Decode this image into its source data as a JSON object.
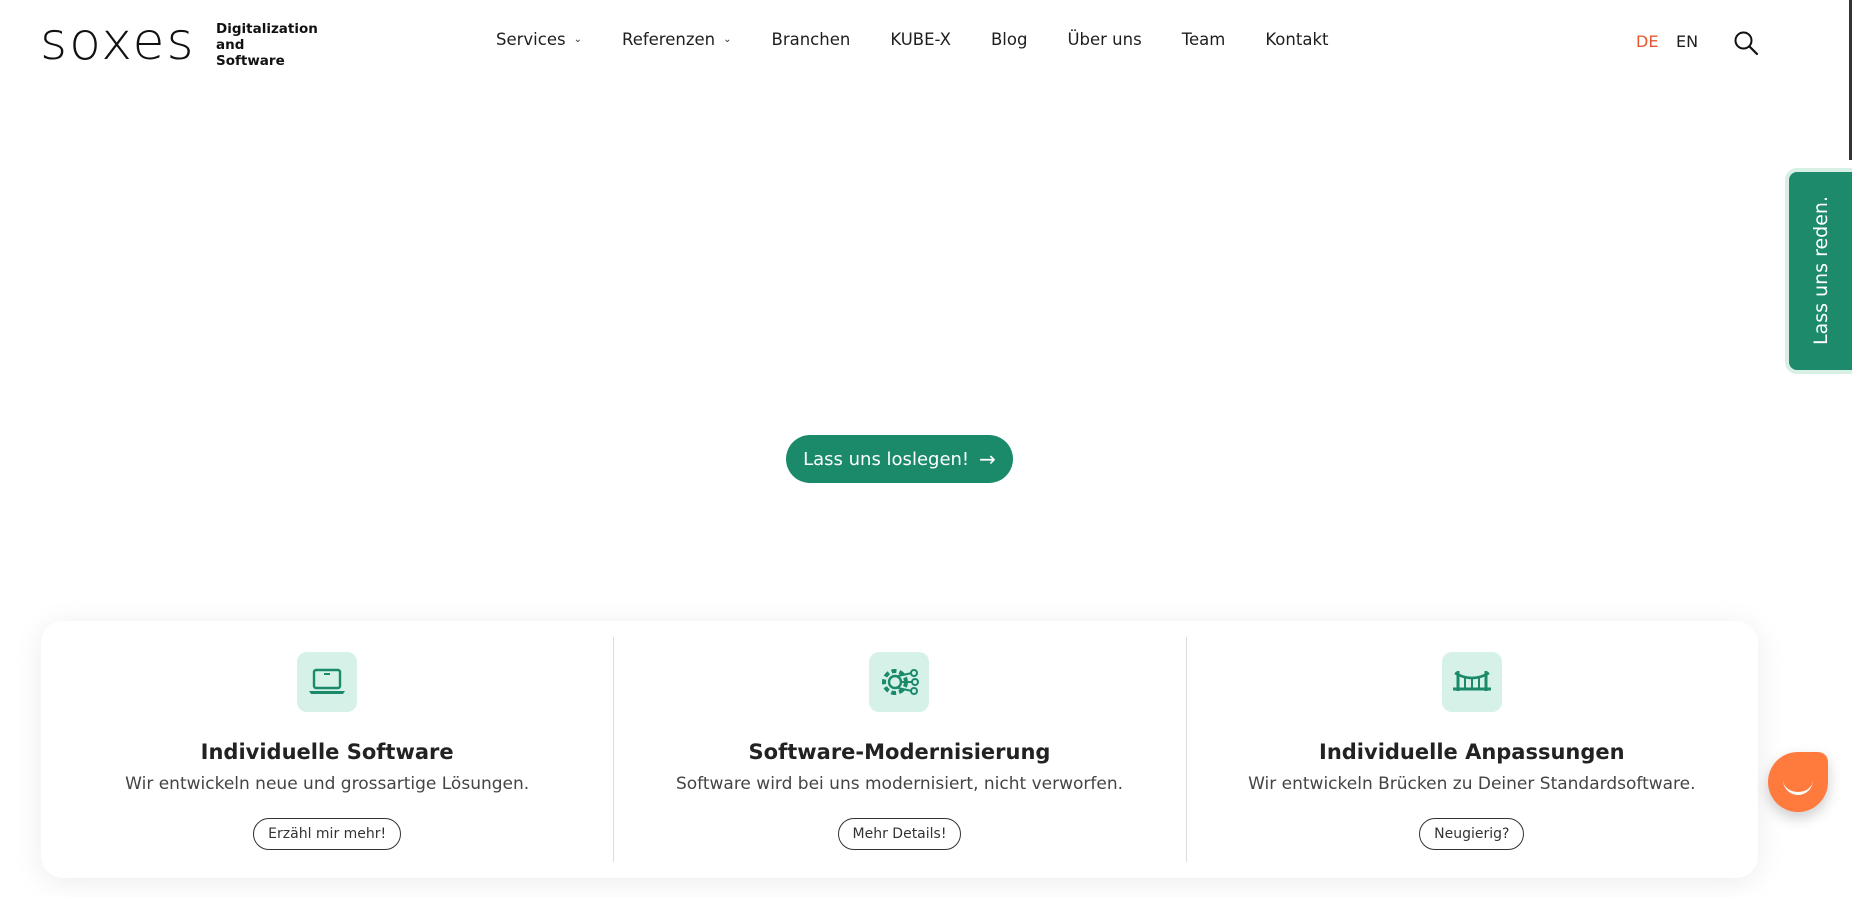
{
  "logo": {
    "wordmark": "soxes",
    "tagline_line1": "Digitalization and",
    "tagline_line2": "Software"
  },
  "nav": {
    "items": [
      {
        "label": "Services",
        "dropdown": true
      },
      {
        "label": "Referenzen",
        "dropdown": true
      },
      {
        "label": "Branchen",
        "dropdown": false
      },
      {
        "label": "KUBE-X",
        "dropdown": false
      },
      {
        "label": "Blog",
        "dropdown": false
      },
      {
        "label": "Über uns",
        "dropdown": false
      },
      {
        "label": "Team",
        "dropdown": false
      },
      {
        "label": "Kontakt",
        "dropdown": false
      }
    ],
    "chevron": "⌄"
  },
  "languages": {
    "de": "DE",
    "en": "EN"
  },
  "side_tab": {
    "label": "Lass uns reden."
  },
  "cta": {
    "label": "Lass uns loslegen!",
    "arrow": "→"
  },
  "cards": [
    {
      "icon": "laptop-icon",
      "title": "Individuelle Software",
      "desc": "Wir entwickeln neue und grossartige Lösungen.",
      "button": "Erzähl mir mehr!"
    },
    {
      "icon": "gear-network-icon",
      "title": "Software-Modernisierung",
      "desc": "Software wird bei uns modernisiert, nicht verworfen.",
      "button": "Mehr Details!"
    },
    {
      "icon": "bridge-icon",
      "title": "Individuelle Anpassungen",
      "desc": "Wir entwickeln Brücken zu Deiner Standardsoftware.",
      "button": "Neugierig?"
    }
  ],
  "colors": {
    "accent": "#1b8a6a",
    "active_lang": "#e4572e",
    "chat": "#ff7a3d",
    "icon_bg": "#d6f1e8"
  }
}
